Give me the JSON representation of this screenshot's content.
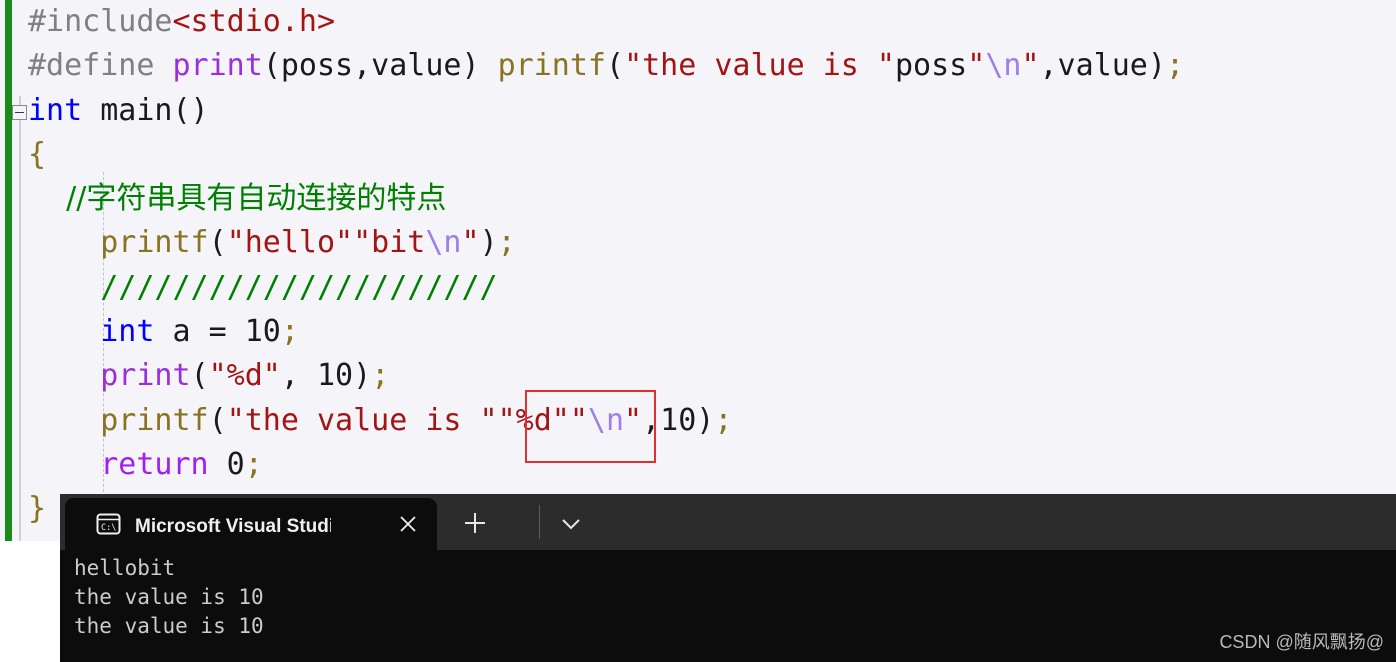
{
  "editor": {
    "background_color": "#f4f4f9",
    "change_bar_color": "#1a8a1a",
    "collapse_marker": "-",
    "lines": [
      {
        "id": "line-include",
        "tokens": [
          {
            "t": "#include",
            "c": "pp"
          },
          {
            "t": "<stdio.h>",
            "c": "str"
          }
        ]
      },
      {
        "id": "line-define",
        "tokens": [
          {
            "t": "#define ",
            "c": "pp"
          },
          {
            "t": "print",
            "c": "macro"
          },
          {
            "t": "(poss,value) ",
            "c": "plain"
          },
          {
            "t": "printf",
            "c": "fn"
          },
          {
            "t": "(",
            "c": "punct"
          },
          {
            "t": "\"the value is \"",
            "c": "str"
          },
          {
            "t": "poss",
            "c": "plain"
          },
          {
            "t": "\"",
            "c": "str"
          },
          {
            "t": "\\n",
            "c": "esc"
          },
          {
            "t": "\"",
            "c": "str"
          },
          {
            "t": ",value)",
            "c": "plain"
          },
          {
            "t": ";",
            "c": "semi"
          }
        ]
      },
      {
        "id": "line-main",
        "tokens": [
          {
            "t": "int",
            "c": "kw"
          },
          {
            "t": " main()",
            "c": "plain"
          }
        ]
      },
      {
        "id": "line-open-brace",
        "tokens": [
          {
            "t": "{",
            "c": "semi"
          }
        ]
      },
      {
        "id": "line-comment-cjk",
        "tokens": [
          {
            "t": "    //字符串具有自动连接的特点",
            "c": "cmt"
          }
        ]
      },
      {
        "id": "line-printf-hello",
        "tokens": [
          {
            "t": "    ",
            "c": "plain"
          },
          {
            "t": "printf",
            "c": "fn"
          },
          {
            "t": "(",
            "c": "punct"
          },
          {
            "t": "\"hello\"\"bit",
            "c": "str"
          },
          {
            "t": "\\n",
            "c": "esc"
          },
          {
            "t": "\"",
            "c": "str"
          },
          {
            "t": ")",
            "c": "punct"
          },
          {
            "t": ";",
            "c": "semi"
          }
        ]
      },
      {
        "id": "line-comment-slashes",
        "tokens": [
          {
            "t": "    //////////////////////",
            "c": "cmt"
          }
        ]
      },
      {
        "id": "line-int-a",
        "tokens": [
          {
            "t": "    ",
            "c": "plain"
          },
          {
            "t": "int",
            "c": "kw"
          },
          {
            "t": " a = ",
            "c": "plain"
          },
          {
            "t": "10",
            "c": "plain"
          },
          {
            "t": ";",
            "c": "semi"
          }
        ]
      },
      {
        "id": "line-print-macro-call",
        "tokens": [
          {
            "t": "    ",
            "c": "plain"
          },
          {
            "t": "print",
            "c": "macro"
          },
          {
            "t": "(",
            "c": "punct"
          },
          {
            "t": "\"%d\"",
            "c": "str"
          },
          {
            "t": ", 10)",
            "c": "plain"
          },
          {
            "t": ";",
            "c": "semi"
          }
        ]
      },
      {
        "id": "line-printf-value",
        "tokens": [
          {
            "t": "    ",
            "c": "plain"
          },
          {
            "t": "printf",
            "c": "fn"
          },
          {
            "t": "(",
            "c": "punct"
          },
          {
            "t": "\"the value is \"\"%d\"\"",
            "c": "str"
          },
          {
            "t": "\\n",
            "c": "esc"
          },
          {
            "t": "\"",
            "c": "str"
          },
          {
            "t": ",10)",
            "c": "plain"
          },
          {
            "t": ";",
            "c": "semi"
          }
        ]
      },
      {
        "id": "line-return",
        "tokens": [
          {
            "t": "    ",
            "c": "plain"
          },
          {
            "t": "return",
            "c": "ctl"
          },
          {
            "t": " 0",
            "c": "plain"
          },
          {
            "t": ";",
            "c": "semi"
          }
        ]
      },
      {
        "id": "line-close-brace",
        "tokens": [
          {
            "t": "}",
            "c": "semi"
          }
        ]
      }
    ]
  },
  "annotation": {
    "name": "red-highlight-rectangle",
    "color": "#e03030",
    "target_text": "\"\"%d\"\""
  },
  "terminal": {
    "background_color": "#0c0c0c",
    "tabbar_color": "#2c2c2c",
    "tab": {
      "icon_name": "console-icon",
      "title": "Microsoft Visual Studio 调试挃",
      "close_label": "×"
    },
    "new_tab_label": "+",
    "dropdown_label": "⌄",
    "output": "hellobit\nthe value is 10\nthe value is 10"
  },
  "watermark": {
    "text": "CSDN @随风飘扬@"
  }
}
